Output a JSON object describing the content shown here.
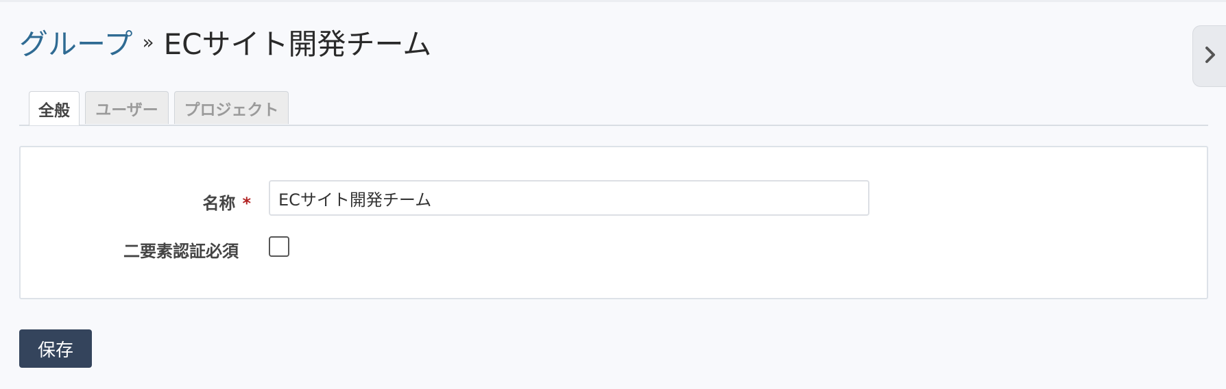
{
  "breadcrumb": {
    "parent_label": "グループ",
    "separator": "»",
    "current": "ECサイト開発チーム"
  },
  "sidebar_toggle": {
    "icon": "chevron-right-icon"
  },
  "tabs": [
    {
      "label": "全般",
      "active": true
    },
    {
      "label": "ユーザー",
      "active": false
    },
    {
      "label": "プロジェクト",
      "active": false
    }
  ],
  "form": {
    "name": {
      "label": "名称",
      "required_mark": "*",
      "value": "ECサイト開発チーム"
    },
    "twofa": {
      "label": "二要素認証必須",
      "checked": false
    }
  },
  "actions": {
    "save_label": "保存"
  },
  "colors": {
    "link": "#2f6b93",
    "primary_button": "#34445c",
    "required": "#b22222",
    "background": "#f8f9fc"
  }
}
